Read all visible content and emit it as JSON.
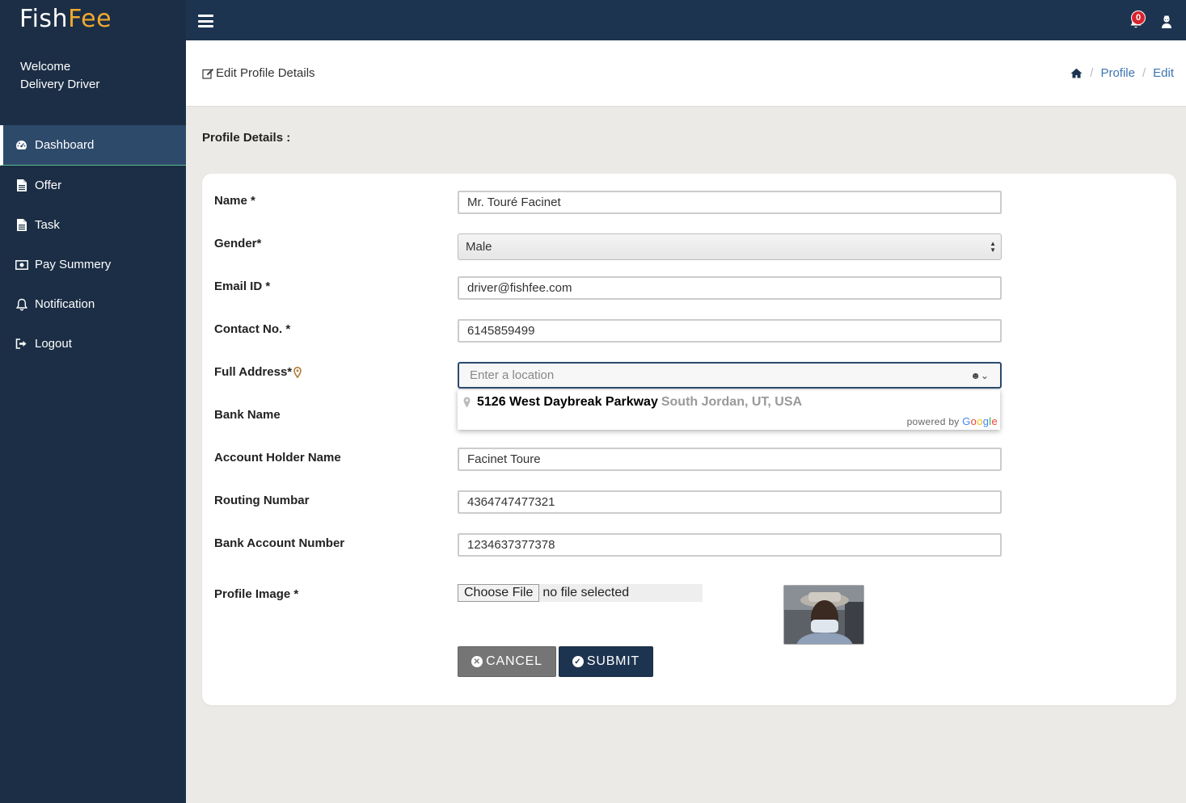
{
  "brand": {
    "part1": "Fish",
    "part2": "Fee",
    "accent_color": "#f0a830"
  },
  "sidebar": {
    "welcome_line1": "Welcome",
    "welcome_line2": "Delivery Driver",
    "items": [
      {
        "label": "Dashboard",
        "icon": "dashboard-icon",
        "active": true
      },
      {
        "label": "Offer",
        "icon": "document-icon"
      },
      {
        "label": "Task",
        "icon": "document-icon"
      },
      {
        "label": "Pay Summery",
        "icon": "money-icon"
      },
      {
        "label": "Notification",
        "icon": "bell-icon"
      },
      {
        "label": "Logout",
        "icon": "logout-icon"
      }
    ]
  },
  "topbar": {
    "notification_count": "0"
  },
  "header": {
    "title": "Edit Profile Details",
    "breadcrumb": {
      "profile": "Profile",
      "edit": "Edit"
    }
  },
  "section_title": "Profile Details :",
  "form": {
    "name_label": "Name *",
    "name_value": "Mr. Touré Facinet",
    "gender_label": "Gender*",
    "gender_value": "Male",
    "email_label": "Email ID *",
    "email_value": "driver@fishfee.com",
    "contact_label": "Contact No. *",
    "contact_value": "6145859499",
    "address_label": "Full Address*",
    "address_placeholder": "Enter a location",
    "suggestion_main": "5126 West Daybreak Parkway",
    "suggestion_secondary": "South Jordan, UT, USA",
    "powered_by": "powered by",
    "google": "Google",
    "bank_label": "Bank Name",
    "holder_label": "Account Holder Name",
    "holder_value": "Facinet Toure",
    "routing_label": "Routing Numbar",
    "routing_value": "4364747477321",
    "account_label": "Bank Account Number",
    "account_value": "1234637377378",
    "image_label": "Profile Image *",
    "choose_file": "Choose File",
    "no_file": "no file selected",
    "cancel": "CANCEL",
    "submit": "SUBMIT"
  }
}
